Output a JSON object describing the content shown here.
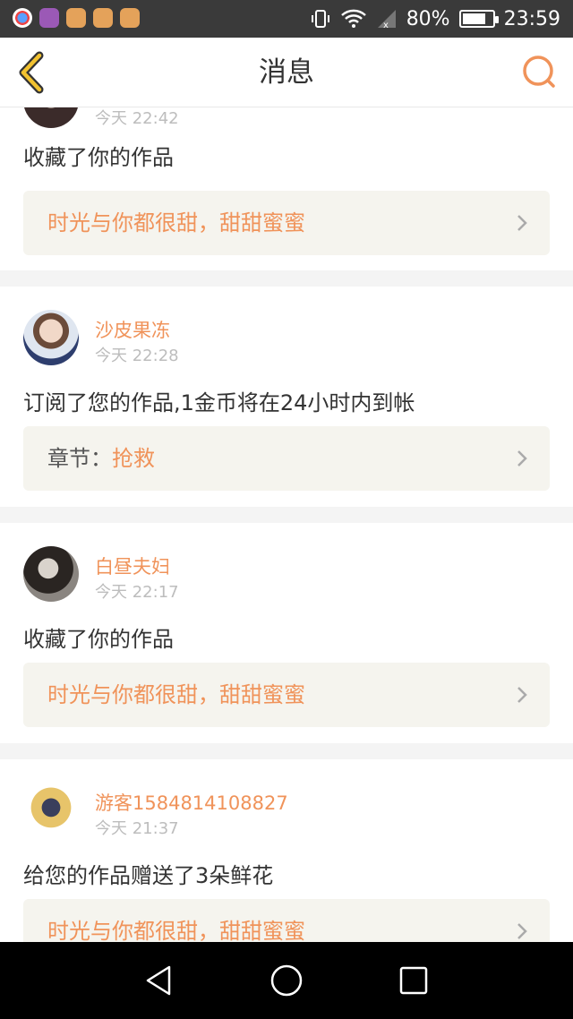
{
  "status_bar": {
    "battery_percent": "80%",
    "battery_level": 0.8,
    "time": "23:59",
    "icons": [
      "app-blue-icon",
      "gallery-icon",
      "treasure-cart-icon",
      "treasure-cart-icon",
      "treasure-cart-icon",
      "vibrate-icon",
      "wifi-icon",
      "signal-icon",
      "battery-icon"
    ]
  },
  "navbar": {
    "title": "消息",
    "back_icon": "chevron-left-icon",
    "search_icon": "search-icon"
  },
  "messages": [
    {
      "username": "",
      "time": "今天 22:42",
      "action": "收藏了你的作品",
      "work_label": "",
      "work_title": "时光与你都很甜，甜甜蜜蜜"
    },
    {
      "username": "沙皮果冻",
      "time": "今天 22:28",
      "action": "订阅了您的作品,1金币将在24小时内到帐",
      "work_label": "章节：",
      "work_title": "抢救"
    },
    {
      "username": "白昼夫妇",
      "time": "今天 22:17",
      "action": "收藏了你的作品",
      "work_label": "",
      "work_title": "时光与你都很甜，甜甜蜜蜜"
    },
    {
      "username": "游客1584814108827",
      "time": "今天 21:37",
      "action": "给您的作品赠送了3朵鲜花",
      "work_label": "",
      "work_title": "时光与你都很甜，甜甜蜜蜜"
    }
  ],
  "system_nav": {
    "buttons": [
      "back-triangle-icon",
      "home-circle-icon",
      "recents-square-icon"
    ]
  },
  "colors": {
    "accent": "#f0935a",
    "box_bg": "#f5f4ee",
    "status_bar_bg": "#3a3a3a",
    "nav_icon_yellow": "#f2c230"
  }
}
